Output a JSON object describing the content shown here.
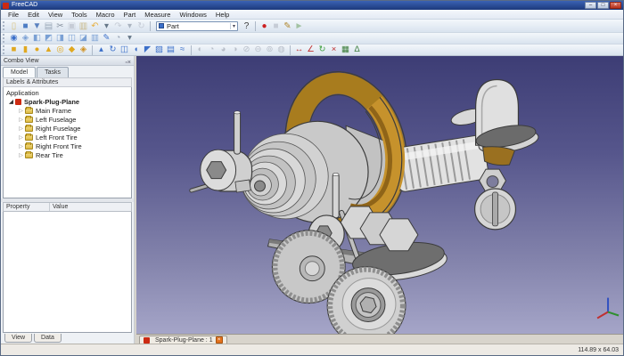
{
  "window": {
    "title": "FreeCAD",
    "controls": [
      {
        "name": "minimize-button",
        "glyph": "–"
      },
      {
        "name": "maximize-button",
        "glyph": "□"
      },
      {
        "name": "close-button",
        "glyph": "×"
      }
    ]
  },
  "menu": {
    "items": [
      {
        "name": "menu-file",
        "label": "File"
      },
      {
        "name": "menu-edit",
        "label": "Edit"
      },
      {
        "name": "menu-view",
        "label": "View"
      },
      {
        "name": "menu-tools",
        "label": "Tools"
      },
      {
        "name": "menu-macro",
        "label": "Macro"
      },
      {
        "name": "menu-part",
        "label": "Part"
      },
      {
        "name": "menu-measure",
        "label": "Measure"
      },
      {
        "name": "menu-windows",
        "label": "Windows"
      },
      {
        "name": "menu-help",
        "label": "Help"
      }
    ]
  },
  "toolbar_file": {
    "icons": [
      {
        "name": "new-file-icon",
        "glyph": "▯",
        "color": "#d8c27a"
      },
      {
        "name": "open-file-icon",
        "glyph": "■",
        "color": "#4d7dc4"
      },
      {
        "name": "save-file-icon",
        "glyph": "▼",
        "color": "#5b82c0"
      },
      {
        "name": "print-icon",
        "glyph": "▤",
        "color": "#9aa8b8"
      },
      {
        "name": "cut-icon",
        "glyph": "✂",
        "color": "#8a94a2"
      },
      {
        "name": "copy-icon",
        "glyph": "▣",
        "color": "#c6ccd6"
      },
      {
        "name": "paste-icon",
        "glyph": "▥",
        "color": "#c8b98a"
      },
      {
        "name": "undo-icon",
        "glyph": "↶",
        "color": "#e8b040"
      },
      {
        "name": "undo-menu-arrow-icon",
        "glyph": "▾",
        "color": "#667788"
      },
      {
        "name": "redo-icon",
        "glyph": "↷",
        "color": "#c6ccd6"
      },
      {
        "name": "redo-menu-arrow-icon",
        "glyph": "▾",
        "color": "#aab4c0"
      },
      {
        "name": "refresh-icon",
        "glyph": "↻",
        "color": "#c6ccd6"
      }
    ]
  },
  "workbench_selector": {
    "value": "Part"
  },
  "help_icon": {
    "glyph": "?"
  },
  "toolbar_macro": {
    "icons": [
      {
        "name": "record-macro-icon",
        "glyph": "●",
        "color": "#cc2020"
      },
      {
        "name": "stop-macro-icon",
        "glyph": "■",
        "color": "#c6ccd6"
      },
      {
        "name": "edit-macro-icon",
        "glyph": "✎",
        "color": "#b08830"
      },
      {
        "name": "run-macro-icon",
        "glyph": "►",
        "color": "#a2c2a2"
      }
    ]
  },
  "toolbar_view": {
    "icons": [
      {
        "name": "fit-all-icon",
        "glyph": "◉",
        "color": "#3b6fc9"
      },
      {
        "name": "axonometric-view-icon",
        "glyph": "◈",
        "color": "#7aa0d4"
      },
      {
        "name": "front-view-icon",
        "glyph": "◧",
        "color": "#7aa0d4"
      },
      {
        "name": "top-view-icon",
        "glyph": "◩",
        "color": "#7aa0d4"
      },
      {
        "name": "right-view-icon",
        "glyph": "◨",
        "color": "#7aa0d4"
      },
      {
        "name": "rear-view-icon",
        "glyph": "◫",
        "color": "#7aa0d4"
      },
      {
        "name": "bottom-view-icon",
        "glyph": "◪",
        "color": "#7aa0d4"
      },
      {
        "name": "left-view-icon",
        "glyph": "▥",
        "color": "#7aa0d4"
      },
      {
        "name": "measure-sketch-icon",
        "glyph": "✎",
        "color": "#3b6fc9"
      },
      {
        "name": "clipping-plane-icon",
        "glyph": "◔",
        "color": "#9aa4b4"
      },
      {
        "name": "view-menu-arrow-icon",
        "glyph": "▾",
        "color": "#667788"
      }
    ]
  },
  "toolbar_part_primitives": {
    "icons": [
      {
        "name": "part-box-icon",
        "glyph": "■",
        "color": "#e0a820"
      },
      {
        "name": "part-cylinder-icon",
        "glyph": "▮",
        "color": "#e0a820"
      },
      {
        "name": "part-sphere-icon",
        "glyph": "●",
        "color": "#e0a820"
      },
      {
        "name": "part-cone-icon",
        "glyph": "▲",
        "color": "#e0a820"
      },
      {
        "name": "part-torus-icon",
        "glyph": "◎",
        "color": "#e0a820"
      },
      {
        "name": "part-primitives-icon",
        "glyph": "◆",
        "color": "#e0a820"
      },
      {
        "name": "shape-builder-icon",
        "glyph": "◈",
        "color": "#d09020"
      }
    ]
  },
  "toolbar_part_modify": {
    "icons": [
      {
        "name": "extrude-icon",
        "glyph": "▴",
        "color": "#3b6fc9"
      },
      {
        "name": "revolve-icon",
        "glyph": "↻",
        "color": "#3b6fc9"
      },
      {
        "name": "mirror-icon",
        "glyph": "◫",
        "color": "#3b6fc9"
      },
      {
        "name": "fillet-icon",
        "glyph": "◖",
        "color": "#3b6fc9"
      },
      {
        "name": "chamfer-icon",
        "glyph": "◤",
        "color": "#3b6fc9"
      },
      {
        "name": "make-face-icon",
        "glyph": "▨",
        "color": "#3b6fc9"
      },
      {
        "name": "loft-icon",
        "glyph": "▤",
        "color": "#3b6fc9"
      },
      {
        "name": "sweep-icon",
        "glyph": "≈",
        "color": "#3b6fc9"
      }
    ]
  },
  "toolbar_part_boolean": {
    "icons": [
      {
        "name": "boolean-icon",
        "glyph": "◐",
        "color": "#b8bec8"
      },
      {
        "name": "boolean-cut-icon",
        "glyph": "◔",
        "color": "#b8bec8"
      },
      {
        "name": "boolean-union-icon",
        "glyph": "◕",
        "color": "#b8bec8"
      },
      {
        "name": "boolean-common-icon",
        "glyph": "◑",
        "color": "#b8bec8"
      },
      {
        "name": "section-icon",
        "glyph": "⊘",
        "color": "#b8bec8"
      },
      {
        "name": "cross-sections-icon",
        "glyph": "⊖",
        "color": "#b8bec8"
      },
      {
        "name": "offset-icon",
        "glyph": "⊚",
        "color": "#b8bec8"
      },
      {
        "name": "thickness-icon",
        "glyph": "◍",
        "color": "#b8bec8"
      }
    ]
  },
  "toolbar_measure": {
    "icons": [
      {
        "name": "measure-linear-icon",
        "glyph": "↔",
        "color": "#c03030"
      },
      {
        "name": "measure-angular-icon",
        "glyph": "∠",
        "color": "#c03030"
      },
      {
        "name": "refresh-measurement-icon",
        "glyph": "↻",
        "color": "#3f9f3f"
      },
      {
        "name": "clear-measurement-icon",
        "glyph": "×",
        "color": "#c03030"
      },
      {
        "name": "toggle-3d-measurement-icon",
        "glyph": "▦",
        "color": "#3f7f3f"
      },
      {
        "name": "toggle-delta-measurement-icon",
        "glyph": "Δ",
        "color": "#3f7f3f"
      }
    ]
  },
  "combo_view": {
    "title": "Combo View",
    "header_buttons": [
      {
        "name": "float-panel-icon",
        "glyph": "▫"
      },
      {
        "name": "close-panel-icon",
        "glyph": "×"
      }
    ],
    "tabs": [
      "Model",
      "Tasks"
    ],
    "tree_header": "Labels & Attributes",
    "root_label": "Application",
    "document_label": "Spark-Plug-Plane",
    "items": [
      {
        "name": "tree-item-main-frame",
        "label": "Main Frame"
      },
      {
        "name": "tree-item-left-fuselage",
        "label": "Left Fuselage"
      },
      {
        "name": "tree-item-right-fuselage",
        "label": "Right Fuselage"
      },
      {
        "name": "tree-item-left-front-tire",
        "label": "Left Front Tire"
      },
      {
        "name": "tree-item-right-front-tire",
        "label": "Right Front Tire"
      },
      {
        "name": "tree-item-rear-tire",
        "label": "Rear Tire"
      }
    ],
    "property_columns": [
      "Property",
      "Value"
    ],
    "bottom_tabs": [
      "View",
      "Data"
    ]
  },
  "viewport": {
    "document_tab": "Spark-Plug-Plane : 1",
    "tab_close_glyph": "×",
    "background_top": "#3d3d75",
    "background_bottom": "#a5a5c8",
    "model_colors": {
      "gold": "#c6922c",
      "silver": "#d2d2d2",
      "dark_plate": "#6b6b6b"
    }
  },
  "status_bar": {
    "dimensions": "114.89 x 64.03"
  }
}
